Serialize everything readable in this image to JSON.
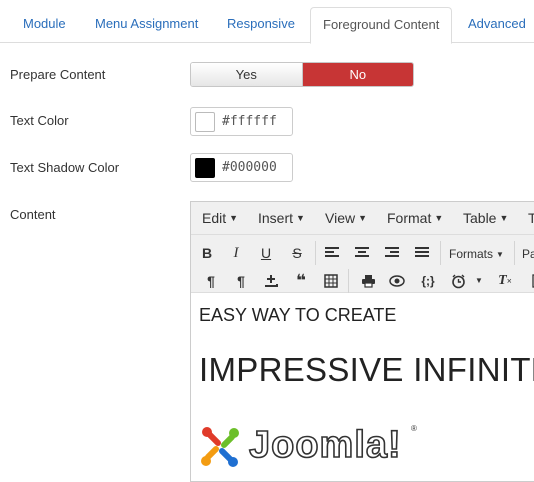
{
  "tabs": [
    {
      "label": "Module"
    },
    {
      "label": "Menu Assignment"
    },
    {
      "label": "Responsive"
    },
    {
      "label": "Foreground Content"
    },
    {
      "label": "Advanced"
    }
  ],
  "active_tab": "Foreground Content",
  "form": {
    "prepare_content": {
      "label": "Prepare Content",
      "yes": "Yes",
      "no": "No",
      "selected": "No"
    },
    "text_color": {
      "label": "Text Color",
      "value": "#ffffff"
    },
    "text_shadow_color": {
      "label": "Text Shadow Color",
      "value": "#000000"
    },
    "content": {
      "label": "Content"
    }
  },
  "editor": {
    "menus": [
      "Edit",
      "Insert",
      "View",
      "Format",
      "Table",
      "T"
    ],
    "formats_label": "Formats",
    "paragraph_label": "Pa",
    "toolbar_row1": [
      "bold-icon",
      "italic-icon",
      "underline-icon",
      "strikethrough-icon",
      "align-left-icon",
      "align-center-icon",
      "align-right-icon",
      "align-justify-icon"
    ],
    "toolbar_row2": [
      "ltr-icon",
      "rtl-icon",
      "anchor-icon",
      "blockquote-icon",
      "table-icon",
      "print-icon",
      "preview-icon",
      "code-sample-icon",
      "date-time-icon",
      "clear-formatting-icon"
    ],
    "content_line1": "EASY WAY TO CREATE",
    "content_line2": "IMPRESSIVE INFINITE S",
    "logo_text": "Joomla!"
  },
  "colors": {
    "accent_link": "#2a6ebb",
    "no_active": "#c73535",
    "joomla_red": "#e03b2a",
    "joomla_orange": "#f39c12",
    "joomla_blue": "#1f6fd1",
    "joomla_green": "#6cbf2a"
  }
}
